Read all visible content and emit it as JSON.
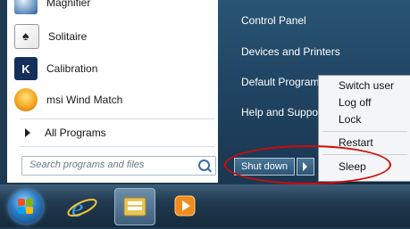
{
  "start_menu": {
    "programs": [
      {
        "label": "Magnifier",
        "icon": "magnifier-icon"
      },
      {
        "label": "Solitaire",
        "icon": "solitaire-icon"
      },
      {
        "label": "Calibration",
        "icon": "calibration-icon"
      },
      {
        "label": "msi Wind Match",
        "icon": "msi-wind-match-icon"
      }
    ],
    "all_programs": "All Programs",
    "search_placeholder": "Search programs and files",
    "right_items": [
      "Control Panel",
      "Devices and Printers",
      "Default Program",
      "Help and Suppor"
    ],
    "shutdown_label": "Shut down"
  },
  "power_menu": {
    "items": [
      "Switch user",
      "Log off",
      "Lock",
      "Restart",
      "Sleep"
    ]
  },
  "taskbar": {
    "icons": [
      "start-orb-icon",
      "internet-explorer-icon",
      "file-explorer-icon",
      "media-player-icon"
    ]
  },
  "annotation": {
    "color": "#d10a0a"
  }
}
